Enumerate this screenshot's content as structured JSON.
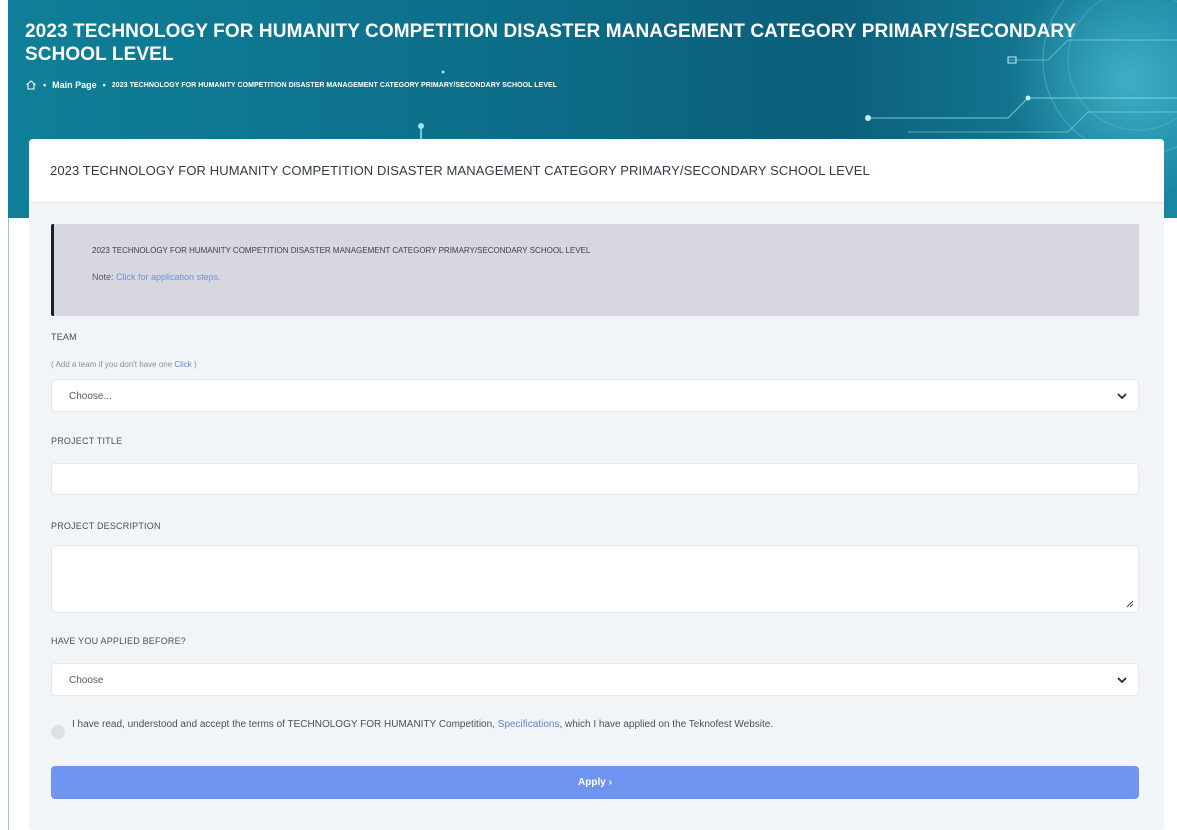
{
  "header": {
    "title": "2023 TECHNOLOGY FOR HUMANITY COMPETITION DISASTER MANAGEMENT CATEGORY PRIMARY/SECONDARY SCHOOL LEVEL",
    "breadcrumb": {
      "home_icon": "home-icon",
      "separator": "•",
      "main_page": "Main Page",
      "current": "2023 TECHNOLOGY FOR HUMANITY COMPETITION DISASTER MANAGEMENT CATEGORY PRIMARY/SECONDARY SCHOOL LEVEL"
    },
    "background_color": "#0d6f8a"
  },
  "card": {
    "title": "2023 TECHNOLOGY FOR HUMANITY COMPETITION DISASTER MANAGEMENT CATEGORY PRIMARY/SECONDARY SCHOOL LEVEL",
    "alert": {
      "text": "2023 TECHNOLOGY FOR HUMANITY COMPETITION DISASTER MANAGEMENT CATEGORY PRIMARY/SECONDARY SCHOOL LEVEL",
      "note_label": "Note:",
      "note_link": "Click for application steps."
    }
  },
  "form": {
    "team": {
      "label": "TEAM",
      "hint_prefix": "( Add a team if you don't have one",
      "hint_link": "Click",
      "hint_suffix": ")",
      "selected": "Choose..."
    },
    "project_title": {
      "label": "PROJECT TITLE",
      "value": ""
    },
    "project_description": {
      "label": "PROJECT DESCRIPTION",
      "value": ""
    },
    "applied_before": {
      "label": "HAVE YOU APPLIED BEFORE?",
      "selected": "Choose"
    },
    "terms": {
      "prefix": "I have read, understood and accept the terms of  TECHNOLOGY FOR HUMANITY Competition,",
      "link": "Specifications",
      "suffix": ", which I have applied on the Teknofest Website.",
      "checked": false
    },
    "apply_button": "Apply ›",
    "accent_color": "#6f95f0"
  }
}
